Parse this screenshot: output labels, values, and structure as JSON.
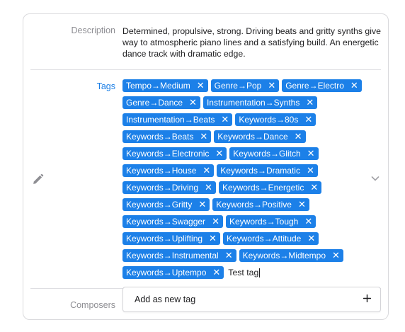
{
  "description": {
    "label": "Description",
    "text": "Determined, propulsive, strong. Driving beats and gritty synths give way to atmospheric piano lines and a satisfying build. An energetic dance track with dramatic edge."
  },
  "tags": {
    "label": "Tags",
    "items": [
      "Tempo→Medium",
      "Genre→Pop",
      "Genre→Electro",
      "Genre→Dance",
      "Instrumentation→Synths",
      "Instrumentation→Beats",
      "Keywords→80s",
      "Keywords→Beats",
      "Keywords→Dance",
      "Keywords→Electronic",
      "Keywords→Glitch",
      "Keywords→House",
      "Keywords→Dramatic",
      "Keywords→Driving",
      "Keywords→Energetic",
      "Keywords→Gritty",
      "Keywords→Positive",
      "Keywords→Swagger",
      "Keywords→Tough",
      "Keywords→Uplifting",
      "Keywords→Attitude",
      "Keywords→Instrumental",
      "Keywords→Midtempo",
      "Keywords→Uptempo"
    ],
    "remove_glyph": "✕",
    "input_value": "Test tag"
  },
  "suggestion": {
    "label": "Add as new tag"
  },
  "composers": {
    "label": "Composers"
  },
  "icons": {
    "edit": "pencil-icon",
    "expand": "chevron-down-icon",
    "add": "plus-icon"
  },
  "colors": {
    "tag_bg": "#1c80e8",
    "tag_text": "#ffffff",
    "tags_label": "#1a7ee6"
  }
}
